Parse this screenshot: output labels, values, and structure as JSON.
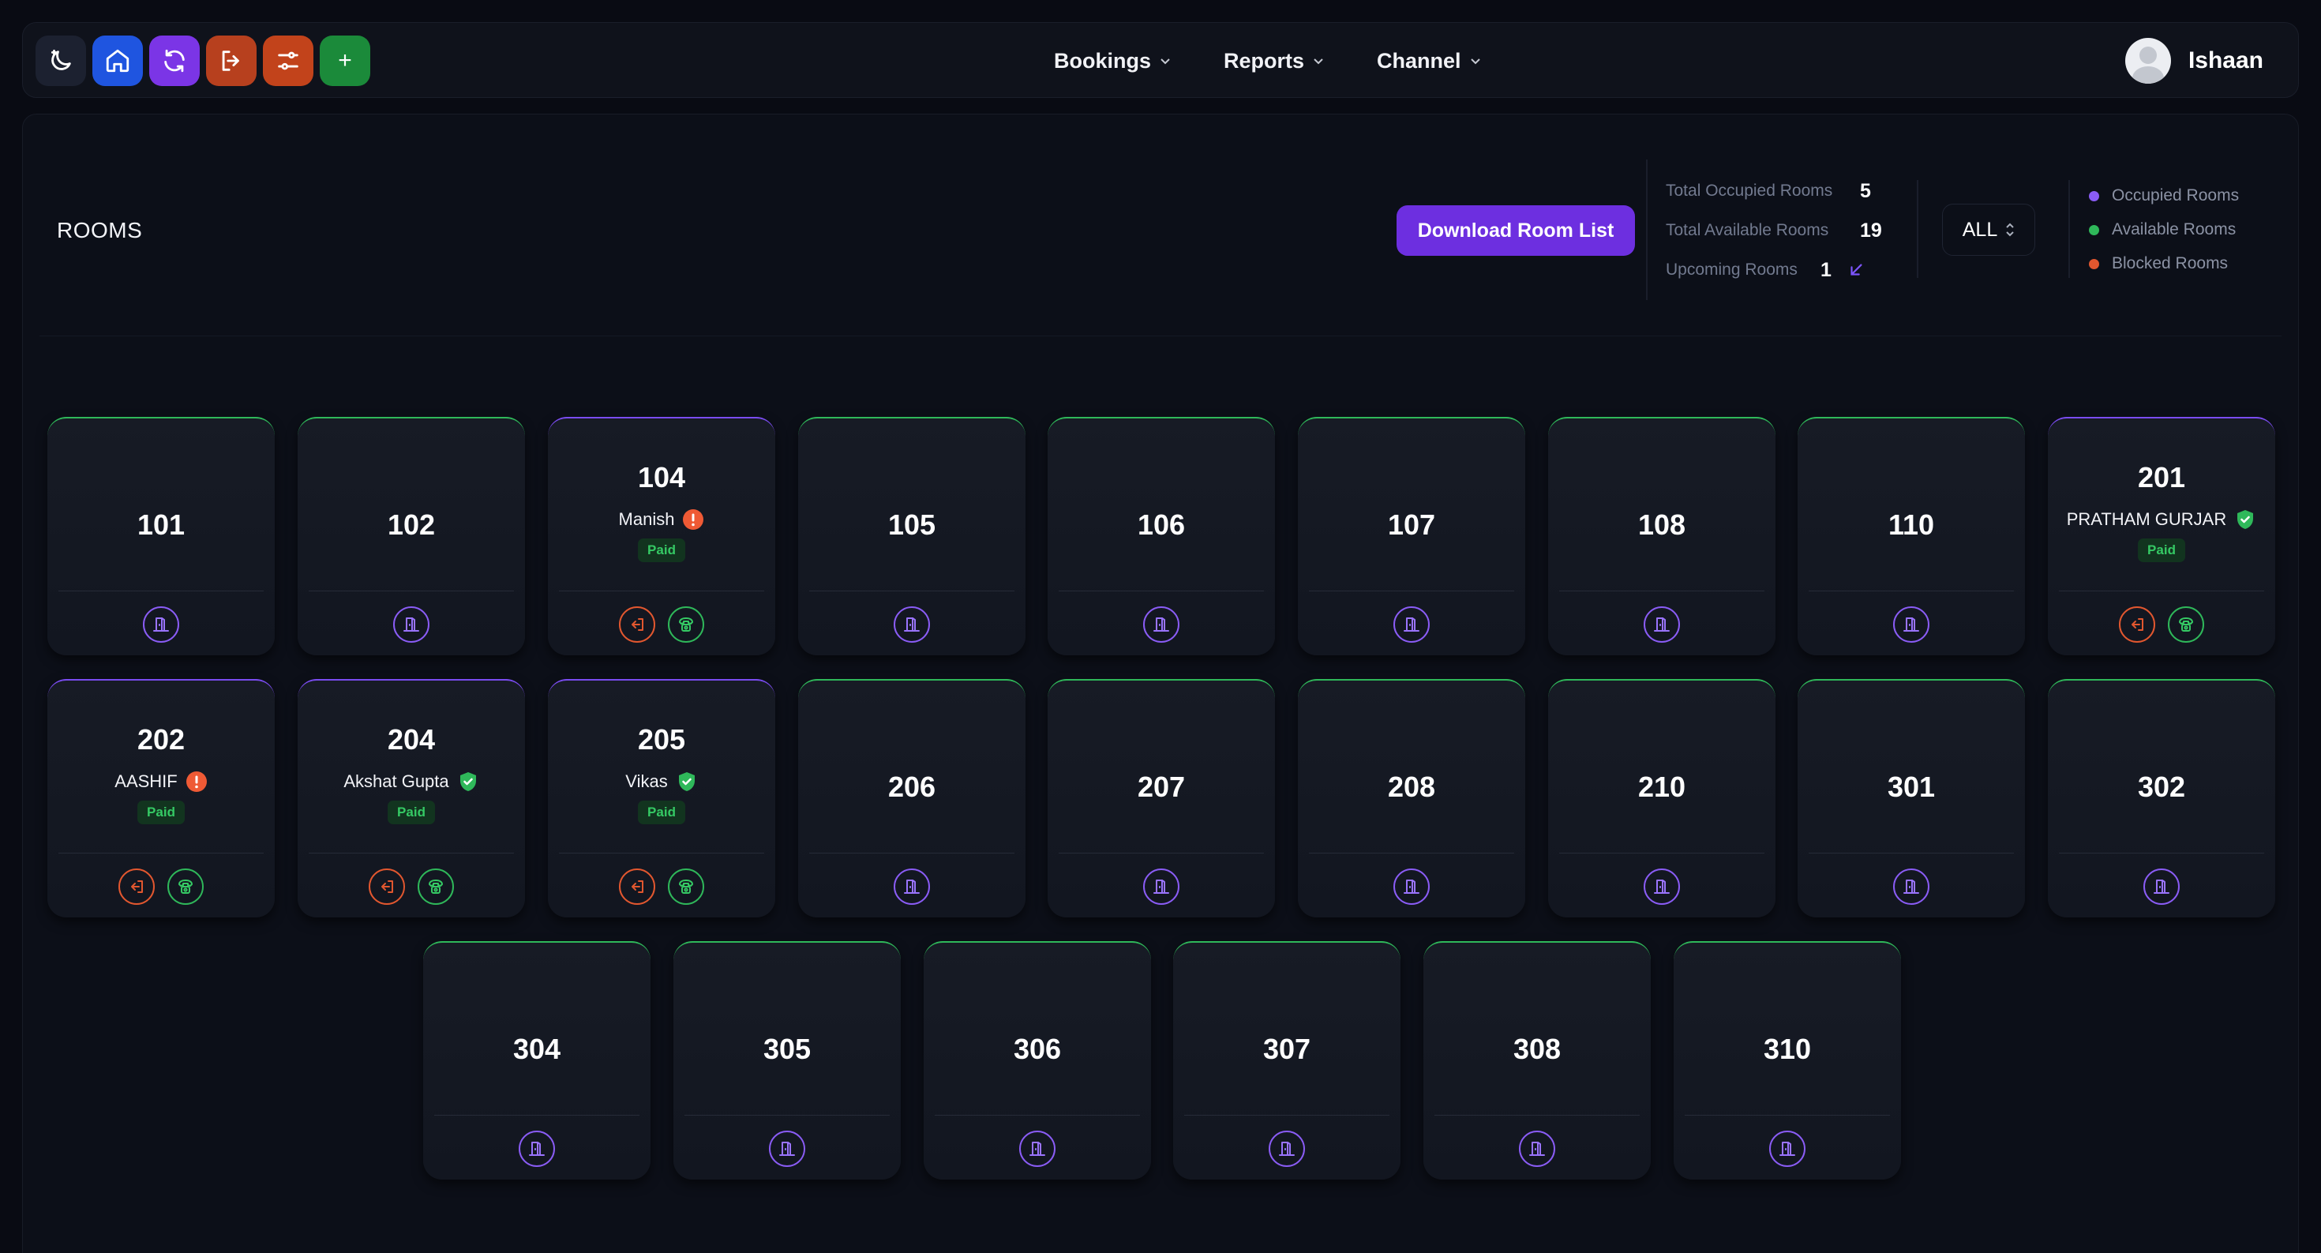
{
  "nav": {
    "quick_actions": [
      {
        "name": "theme-toggle-button",
        "icon": "moon-icon"
      },
      {
        "name": "home-button",
        "icon": "home-icon"
      },
      {
        "name": "refresh-button",
        "icon": "refresh-icon"
      },
      {
        "name": "logout-button",
        "icon": "logout-icon"
      },
      {
        "name": "filter-settings-button",
        "icon": "sliders-icon"
      },
      {
        "name": "add-button",
        "icon": "plus-icon",
        "label": "+"
      }
    ],
    "menu": [
      "Bookings",
      "Reports",
      "Channel"
    ],
    "user_name": "Ishaan"
  },
  "header": {
    "title": "ROOMS",
    "download_label": "Download Room List",
    "stats": [
      {
        "label": "Total Occupied Rooms",
        "value": "5"
      },
      {
        "label": "Total Available Rooms",
        "value": "19"
      },
      {
        "label": "Upcoming Rooms",
        "value": "1"
      }
    ],
    "filter_value": "ALL",
    "legend": [
      {
        "label": "Occupied Rooms",
        "color": "#8a5cf5"
      },
      {
        "label": "Available Rooms",
        "color": "#2fb85a"
      },
      {
        "label": "Blocked Rooms",
        "color": "#e2572f"
      }
    ]
  },
  "colors": {
    "occupied": "#7a4cf0",
    "available": "#2fb85a",
    "blocked": "#e2572f",
    "accent": "#6d2fe0"
  },
  "rooms": [
    {
      "number": "101",
      "status": "available"
    },
    {
      "number": "102",
      "status": "available"
    },
    {
      "number": "104",
      "status": "occupied",
      "guest": "Manish",
      "verified": false,
      "payment": "Paid"
    },
    {
      "number": "105",
      "status": "available"
    },
    {
      "number": "106",
      "status": "available"
    },
    {
      "number": "107",
      "status": "available"
    },
    {
      "number": "108",
      "status": "available"
    },
    {
      "number": "110",
      "status": "available"
    },
    {
      "number": "201",
      "status": "occupied",
      "guest": "PRATHAM GURJAR",
      "verified": true,
      "payment": "Paid"
    },
    {
      "number": "202",
      "status": "occupied",
      "guest": "AASHIF",
      "verified": false,
      "payment": "Paid"
    },
    {
      "number": "204",
      "status": "occupied",
      "guest": "Akshat Gupta",
      "verified": true,
      "payment": "Paid"
    },
    {
      "number": "205",
      "status": "occupied",
      "guest": "Vikas",
      "verified": true,
      "payment": "Paid"
    },
    {
      "number": "206",
      "status": "available"
    },
    {
      "number": "207",
      "status": "available"
    },
    {
      "number": "208",
      "status": "available"
    },
    {
      "number": "210",
      "status": "available"
    },
    {
      "number": "301",
      "status": "available"
    },
    {
      "number": "302",
      "status": "available"
    },
    {
      "number": "304",
      "status": "available"
    },
    {
      "number": "305",
      "status": "available"
    },
    {
      "number": "306",
      "status": "available"
    },
    {
      "number": "307",
      "status": "available"
    },
    {
      "number": "308",
      "status": "available"
    },
    {
      "number": "310",
      "status": "available"
    }
  ]
}
